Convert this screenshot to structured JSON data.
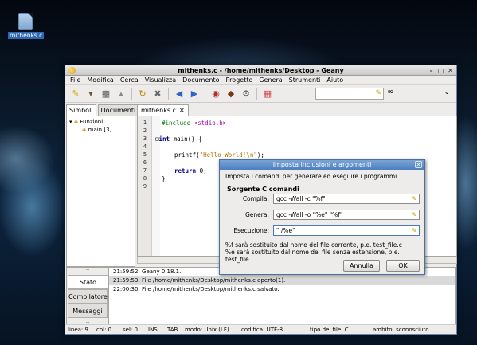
{
  "desktop": {
    "icon_label": "mithenks.c"
  },
  "window": {
    "title": "mithenks.c - /home/mithenks/Desktop - Geany"
  },
  "menu": [
    "File",
    "Modifica",
    "Cerca",
    "Visualizza",
    "Documento",
    "Progetto",
    "Genera",
    "Strumenti",
    "Aiuto"
  ],
  "sidebar": {
    "tabs": [
      "Simboli",
      "Documenti"
    ],
    "tree_root": "Funzioni",
    "tree_item": "main [3]"
  },
  "editor": {
    "tab": "mithenks.c",
    "lines": [
      "1",
      "2",
      "3",
      "4",
      "5",
      "6",
      "7",
      "8",
      "9"
    ]
  },
  "messages": {
    "tabs": [
      "Stato",
      "Compilatore",
      "Messaggi"
    ],
    "lines": [
      "21:59:52: Geany 0.18.1.",
      "21:59:53: File /home/mithenks/Desktop/mithenks.c aperto(1).",
      "22:00:30: File /home/mithenks/Desktop/mithenks.c salvato."
    ]
  },
  "status": {
    "linea": "linea: 9",
    "col": "col: 0",
    "sel": "sel: 0",
    "ins": "INS",
    "tab": "TAB",
    "modo": "modo: Unix (LF)",
    "codifica": "codifica: UTF-8",
    "tipo": "tipo del file: C",
    "ambito": "ambito: sconosciuto"
  },
  "dialog": {
    "title": "Imposta inclusioni e argomenti",
    "desc": "Imposta i comandi per generare ed eseguire i programmi.",
    "section": "Sorgente C comandi",
    "compila_label": "Compila:",
    "compila_value": "gcc -Wall -c \"%f\"",
    "genera_label": "Genera:",
    "genera_value": "gcc -Wall -o \"%e\" \"%f\"",
    "esecuzione_label": "Esecuzione:",
    "esecuzione_value": "\"./%e\"",
    "note1": "%f sarà sostituito dal nome del file corrente, p.e. test_file.c",
    "note2": "%e sarà sostituito dal nome del file senza estensione, p.e. test_file",
    "cancel": "Annulla",
    "ok": "OK"
  }
}
